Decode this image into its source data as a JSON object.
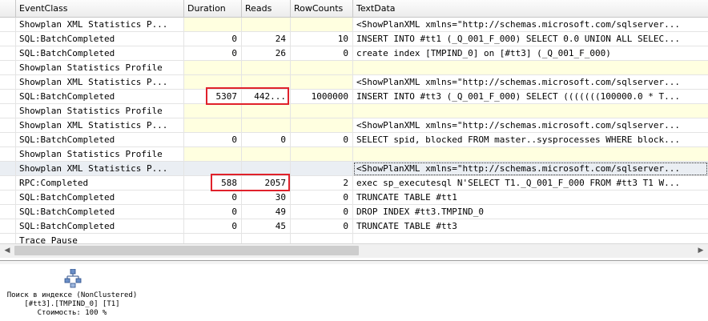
{
  "grid": {
    "columns": [
      "EventClass",
      "Duration",
      "Reads",
      "RowCounts",
      "TextData"
    ],
    "rows": [
      {
        "event": "Showplan XML Statistics P...",
        "duration": "",
        "reads": "",
        "rowcounts": "",
        "text": "<ShowPlanXML xmlns=\"http://schemas.microsoft.com/sqlserver..."
      },
      {
        "event": "SQL:BatchCompleted",
        "duration": "0",
        "reads": "24",
        "rowcounts": "10",
        "text": "INSERT INTO #tt1 (_Q_001_F_000) SELECT 0.0 UNION ALL SELEC..."
      },
      {
        "event": "SQL:BatchCompleted",
        "duration": "0",
        "reads": "26",
        "rowcounts": "0",
        "text": "create index [TMPIND_0] on [#tt3] (_Q_001_F_000)"
      },
      {
        "event": "Showplan Statistics Profile",
        "duration": "",
        "reads": "",
        "rowcounts": "",
        "text": ""
      },
      {
        "event": "Showplan XML Statistics P...",
        "duration": "",
        "reads": "",
        "rowcounts": "",
        "text": "<ShowPlanXML xmlns=\"http://schemas.microsoft.com/sqlserver..."
      },
      {
        "event": "SQL:BatchCompleted",
        "duration": "5307",
        "reads": "442...",
        "rowcounts": "1000000",
        "text": "INSERT INTO #tt3 (_Q_001_F_000) SELECT (((((((100000.0 * T..."
      },
      {
        "event": "Showplan Statistics Profile",
        "duration": "",
        "reads": "",
        "rowcounts": "",
        "text": ""
      },
      {
        "event": "Showplan XML Statistics P...",
        "duration": "",
        "reads": "",
        "rowcounts": "",
        "text": "<ShowPlanXML xmlns=\"http://schemas.microsoft.com/sqlserver..."
      },
      {
        "event": "SQL:BatchCompleted",
        "duration": "0",
        "reads": "0",
        "rowcounts": "0",
        "text": "SELECT spid, blocked FROM master..sysprocesses WHERE block..."
      },
      {
        "event": "Showplan Statistics Profile",
        "duration": "",
        "reads": "",
        "rowcounts": "",
        "text": ""
      },
      {
        "event": "Showplan XML Statistics P...",
        "duration": "",
        "reads": "",
        "rowcounts": "",
        "text": "<ShowPlanXML xmlns=\"http://schemas.microsoft.com/sqlserver..."
      },
      {
        "event": "RPC:Completed",
        "duration": "588",
        "reads": "2057",
        "rowcounts": "2",
        "text": "exec sp_executesql N'SELECT T1._Q_001_F_000 FROM #tt3 T1 W..."
      },
      {
        "event": "SQL:BatchCompleted",
        "duration": "0",
        "reads": "30",
        "rowcounts": "0",
        "text": "TRUNCATE TABLE #tt1"
      },
      {
        "event": "SQL:BatchCompleted",
        "duration": "0",
        "reads": "49",
        "rowcounts": "0",
        "text": "DROP INDEX #tt3.TMPIND_0"
      },
      {
        "event": "SQL:BatchCompleted",
        "duration": "0",
        "reads": "45",
        "rowcounts": "0",
        "text": "TRUNCATE TABLE #tt3"
      },
      {
        "event": "Trace Pause",
        "duration": "",
        "reads": "",
        "rowcounts": "",
        "text": ""
      }
    ]
  },
  "plan": {
    "operator": "Поиск в индексе (NonClustered)",
    "object": "[#tt3].[TMPIND_0] [T1]",
    "cost": "Стоимость: 100 %"
  },
  "colors": {
    "highlight": "#e0212b",
    "yellow_cell": "#ffffe0",
    "selected_row": "#eaeef3"
  },
  "icons": {
    "plan_operator": "index-seek-icon"
  }
}
